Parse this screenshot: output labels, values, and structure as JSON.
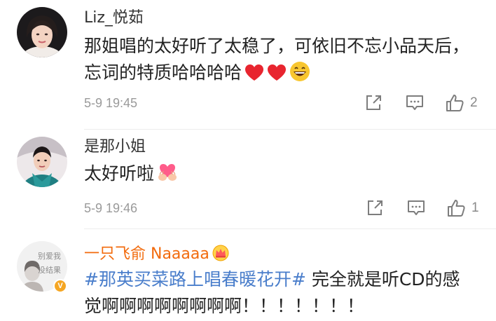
{
  "comments": [
    {
      "username": "Liz_悦茹",
      "text": "那姐唱的太好听了太稳了，可依旧不忘小品天后，忘词的特质哈哈哈哈",
      "emojis": [
        "red-heart",
        "red-heart",
        "grinning-face"
      ],
      "timestamp": "5-9 19:45",
      "likes": "2"
    },
    {
      "username": "是那小姐",
      "text": "太好听啦",
      "emojis": [
        "heart-hands"
      ],
      "timestamp": "5-9 19:46",
      "likes": "1"
    },
    {
      "username": "一只飞俞 Naaaaa",
      "hashtag": "#那英买菜路上唱春暖花开#",
      "text": " 完全就是听CD的感觉啊啊啊啊啊啊啊啊！！！！！！！",
      "avatar_text": "别爱我 没结果",
      "verified": true,
      "username_color": "#f26b0d",
      "badge_icon": "crown-badge-icon"
    }
  ],
  "colors": {
    "hashtag": "#4a7ecb",
    "meta": "#9a9a9a",
    "icon": "#7d7d7d"
  }
}
